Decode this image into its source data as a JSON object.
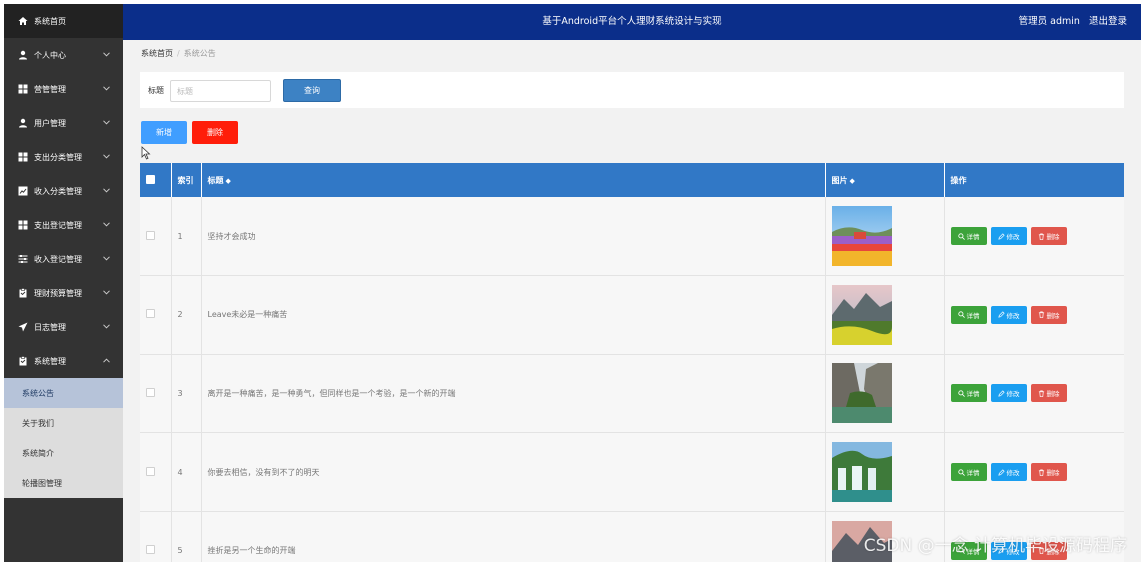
{
  "header": {
    "title": "基于Android平台个人理财系统设计与实现",
    "user": "管理员 admin",
    "logout": "退出登录"
  },
  "sidebar": {
    "items": [
      {
        "label": "系统首页",
        "icon": "home-icon"
      },
      {
        "label": "个人中心",
        "icon": "user-icon"
      },
      {
        "label": "营管管理",
        "icon": "grid-icon"
      },
      {
        "label": "用户管理",
        "icon": "user-icon"
      },
      {
        "label": "支出分类管理",
        "icon": "grid-icon"
      },
      {
        "label": "收入分类管理",
        "icon": "chart-icon"
      },
      {
        "label": "支出登记管理",
        "icon": "grid-icon"
      },
      {
        "label": "收入登记管理",
        "icon": "sliders-icon"
      },
      {
        "label": "理财预算管理",
        "icon": "clipboard-icon"
      },
      {
        "label": "日志管理",
        "icon": "send-icon"
      },
      {
        "label": "系统管理",
        "icon": "clipboard-icon"
      }
    ],
    "submenu": [
      {
        "label": "系统公告",
        "active": true
      },
      {
        "label": "关于我们",
        "active": false
      },
      {
        "label": "系统简介",
        "active": false
      },
      {
        "label": "轮播图管理",
        "active": false
      }
    ]
  },
  "breadcrumb": {
    "home": "系统首页",
    "current": "系统公告"
  },
  "search": {
    "label": "标题",
    "placeholder": "标题",
    "button": "查询"
  },
  "actions": {
    "add": "新增",
    "delete": "删除"
  },
  "table": {
    "columns": {
      "index": "索引",
      "title": "标题",
      "image": "图片",
      "ops": "操作"
    },
    "sort_icon": "◆",
    "op_labels": {
      "detail": "详情",
      "edit": "修改",
      "delete": "删除"
    },
    "rows": [
      {
        "index": "1",
        "title": "坚持才会成功"
      },
      {
        "index": "2",
        "title": "Leave未必是一种痛苦"
      },
      {
        "index": "3",
        "title": "离开是一种痛苦，是一种勇气，但同样也是一个考验，是一个新的开端"
      },
      {
        "index": "4",
        "title": "你要去相信，没有到不了的明天"
      },
      {
        "index": "5",
        "title": "挫折是另一个生命的开端"
      }
    ]
  },
  "watermark": "CSDN @一念 计算机毕设源码程序",
  "colors": {
    "header": "#0b2e8a",
    "sidebar": "#333333",
    "table_header": "#3178c6",
    "add": "#409eff",
    "delete": "#ff1e0a"
  }
}
